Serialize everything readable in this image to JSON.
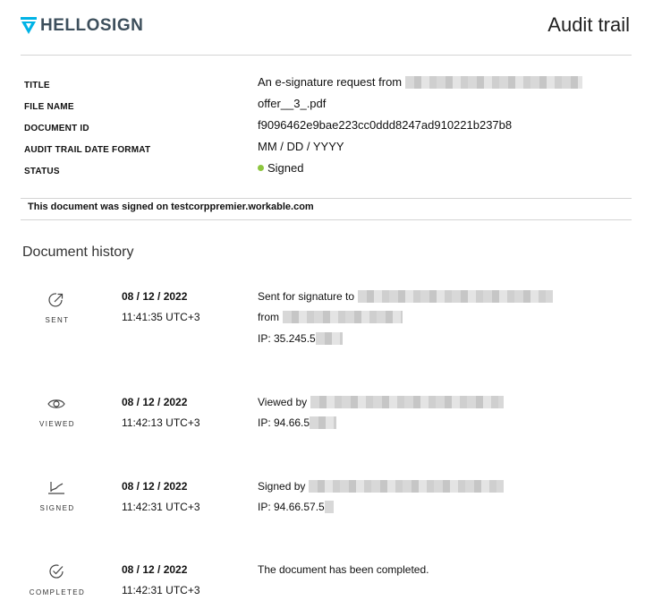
{
  "header": {
    "brand": "HELLOSIGN",
    "title": "Audit trail"
  },
  "meta": [
    {
      "label": "TITLE",
      "value": "An e-signature request from"
    },
    {
      "label": "FILE NAME",
      "value": "offer__3_.pdf"
    },
    {
      "label": "DOCUMENT ID",
      "value": "f9096462e9bae223cc0ddd8247ad910221b237b8"
    },
    {
      "label": "AUDIT TRAIL DATE FORMAT",
      "value": "MM / DD / YYYY"
    },
    {
      "label": "STATUS",
      "value": "Signed"
    }
  ],
  "colors": {
    "status_dot": "#8dc63f",
    "brand": "#3d4f5c",
    "logo_accent": "#00b3e6"
  },
  "signed_note": "This document was signed on testcorppremier.workable.com",
  "history_title": "Document history",
  "events": [
    {
      "icon": "send-icon",
      "label": "SENT",
      "date": "08 / 12 / 2022",
      "time": "11:41:35 UTC+3",
      "lines": [
        "Sent for signature to",
        "from",
        "IP: 35.245.5"
      ]
    },
    {
      "icon": "eye-icon",
      "label": "VIEWED",
      "date": "08 / 12 / 2022",
      "time": "11:42:13 UTC+3",
      "lines": [
        "Viewed by",
        "IP: 94.66.5"
      ]
    },
    {
      "icon": "signature-icon",
      "label": "SIGNED",
      "date": "08 / 12 / 2022",
      "time": "11:42:31 UTC+3",
      "lines": [
        "Signed by",
        "IP: 94.66.57.5"
      ]
    },
    {
      "icon": "check-circle-icon",
      "label": "COMPLETED",
      "date": "08 / 12 / 2022",
      "time": "11:42:31 UTC+3",
      "lines": [
        "The document has been completed."
      ]
    }
  ]
}
